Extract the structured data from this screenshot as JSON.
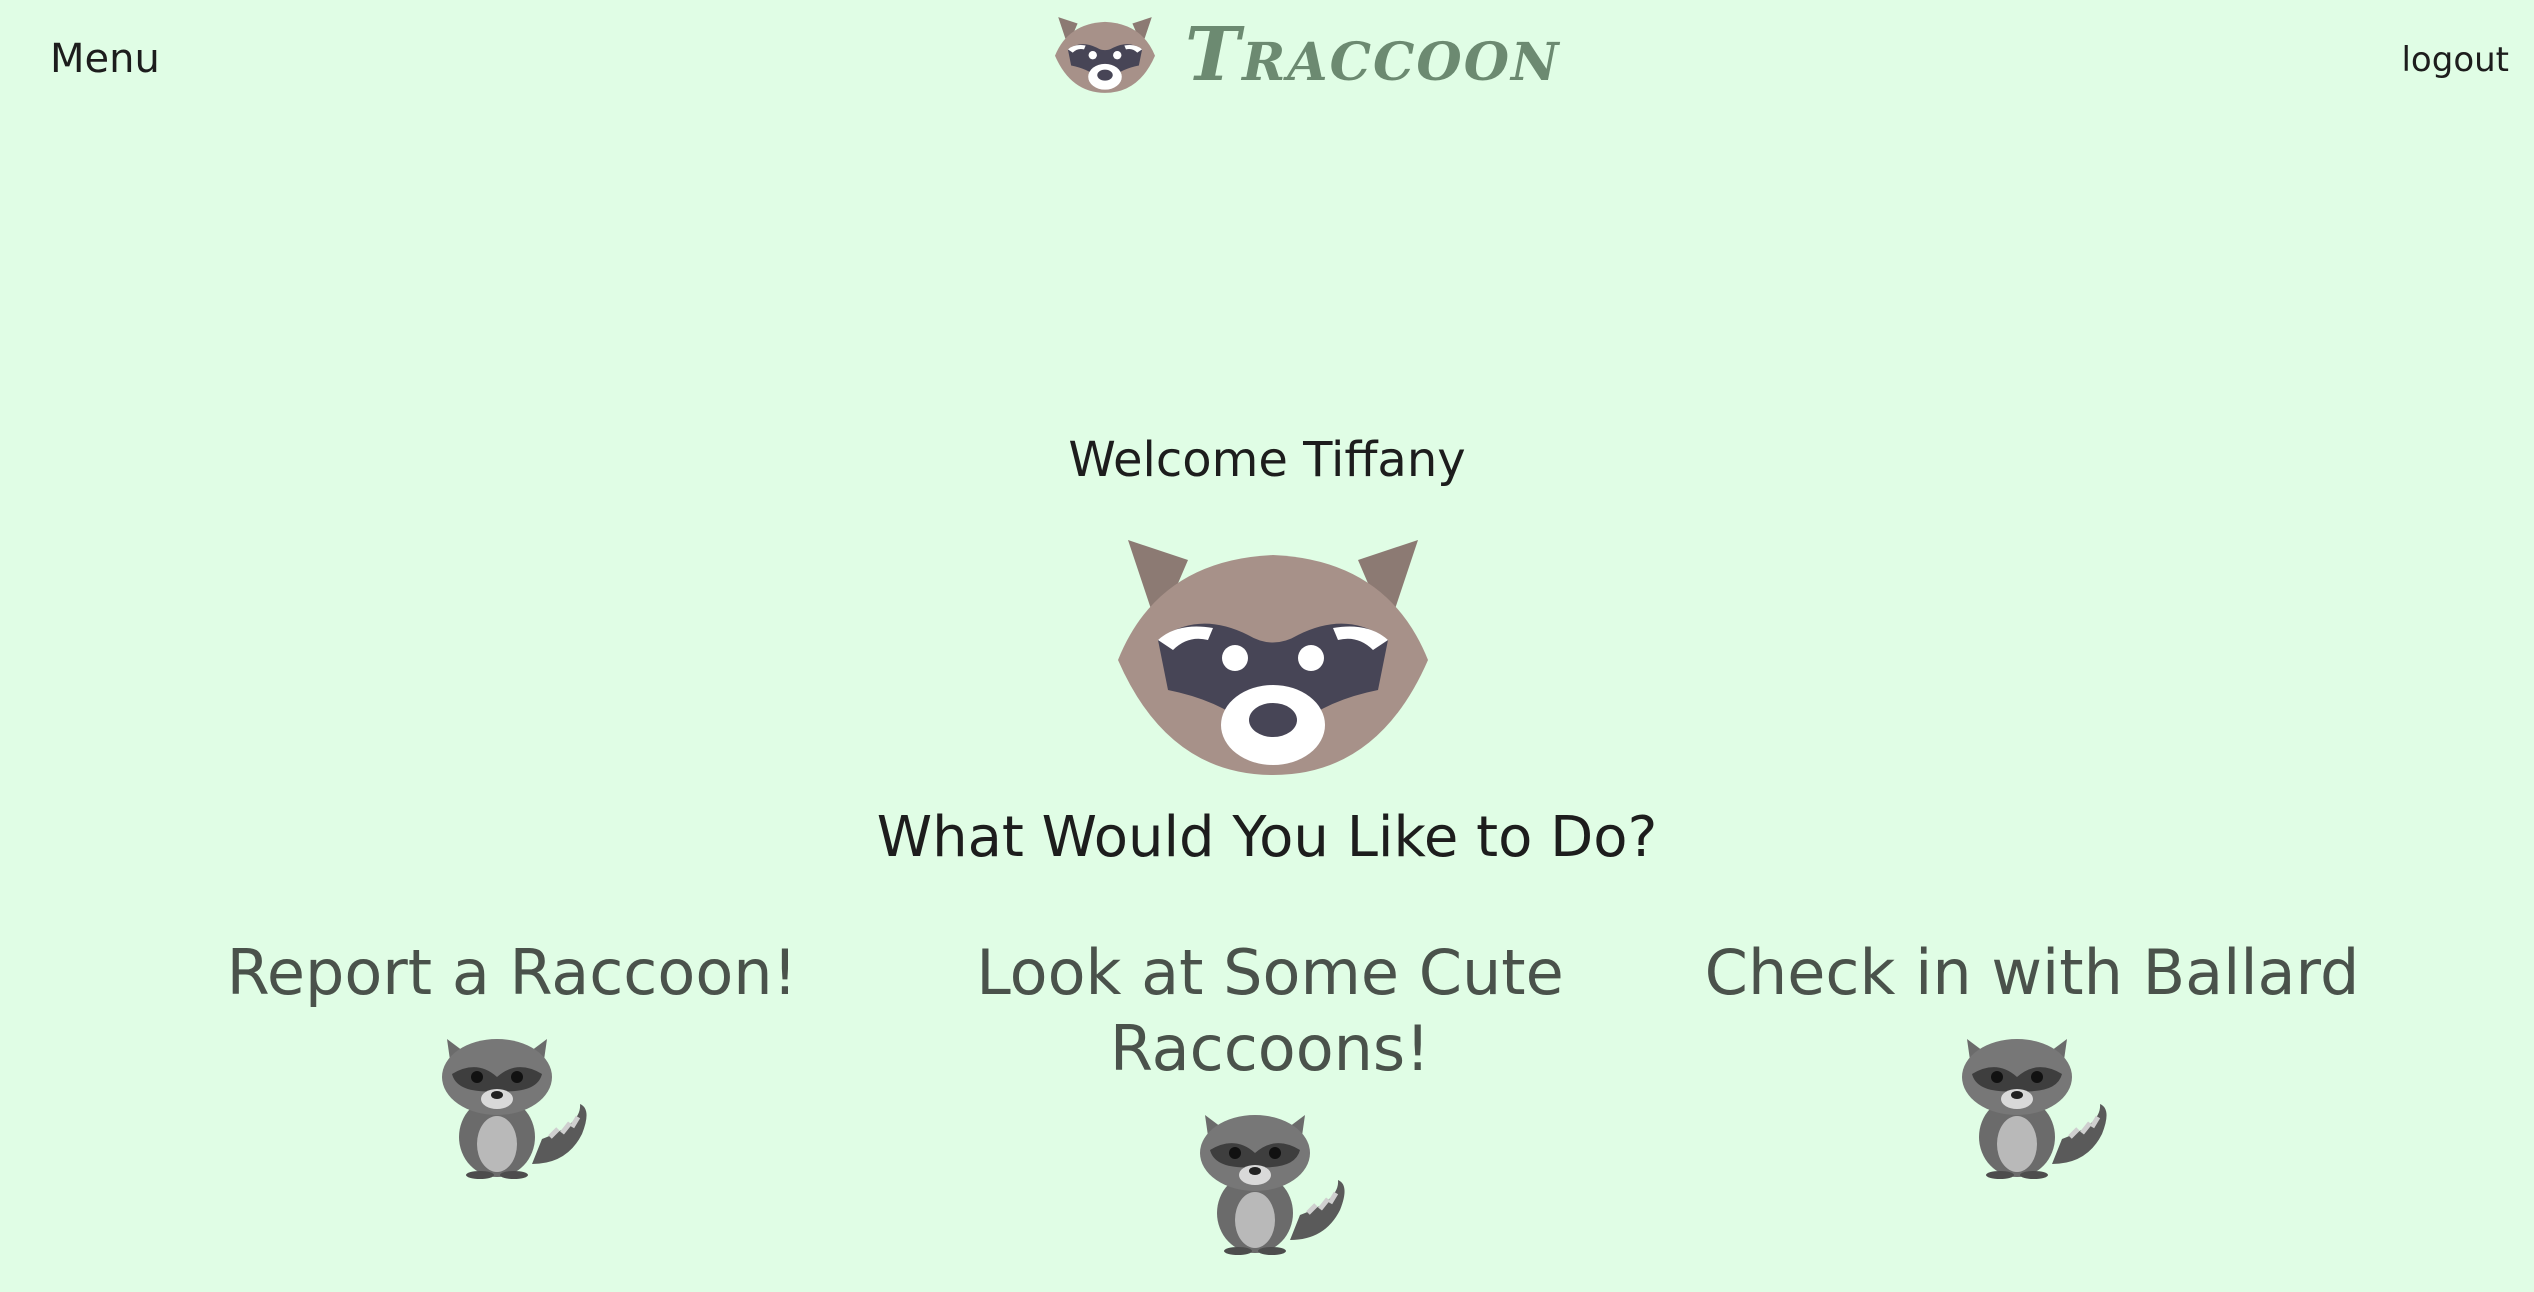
{
  "header": {
    "menu_label": "Menu",
    "brand_name": "Traccoon",
    "logout_label": "logout"
  },
  "main": {
    "welcome_text": "Welcome Tiffany",
    "question_text": "What Would You Like to Do?",
    "options": [
      {
        "label": "Report a Raccoon!",
        "icon": "raccoon-icon"
      },
      {
        "label": "Look at Some Cute Raccoons!",
        "icon": "raccoon-icon"
      },
      {
        "label": "Check in with Ballard",
        "icon": "raccoon-icon"
      }
    ]
  },
  "colors": {
    "background": "#e0fde5",
    "brand": "#6c8a71",
    "raccoon_face": "#a79189",
    "raccoon_mask": "#474556",
    "raccoon_body": "#6b6b6b"
  }
}
